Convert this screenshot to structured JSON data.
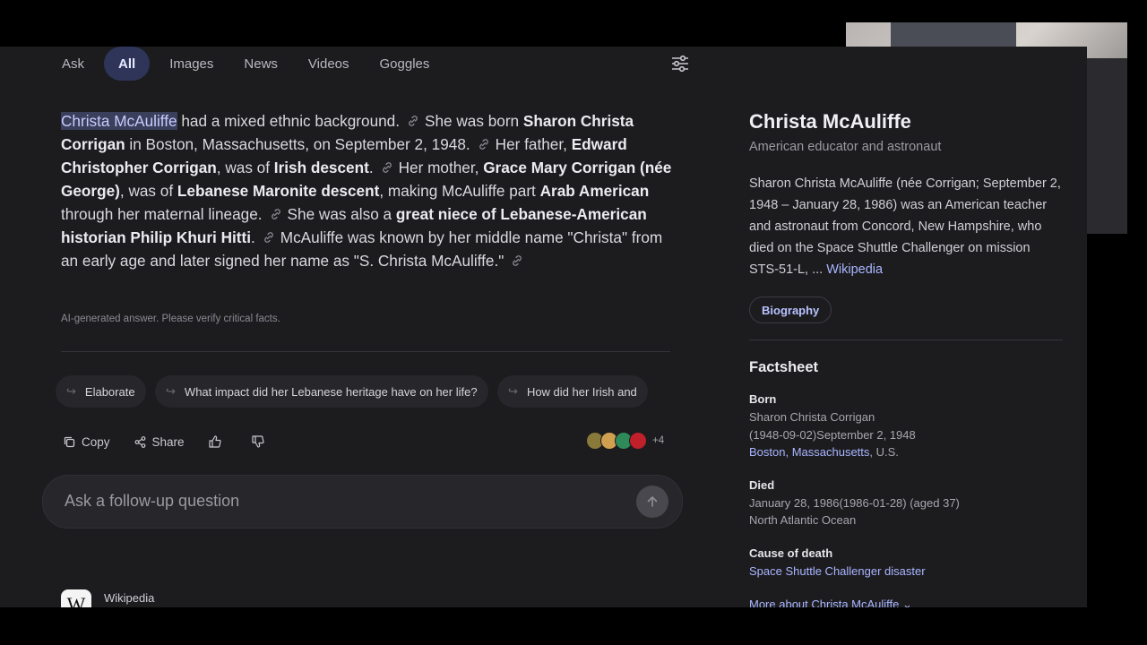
{
  "tabs": [
    {
      "label": "Ask",
      "active": false
    },
    {
      "label": "All",
      "active": true
    },
    {
      "label": "Images",
      "active": false
    },
    {
      "label": "News",
      "active": false
    },
    {
      "label": "Videos",
      "active": false
    },
    {
      "label": "Goggles",
      "active": false
    }
  ],
  "answer": {
    "s1_subject": "Christa McAuliffe",
    "s1_rest": " had a mixed ethnic background.",
    "s2_a": "She was born ",
    "s2_b": "Sharon Christa Corrigan",
    "s2_c": " in Boston, Massachusetts, on September 2, 1948.",
    "s3_a": "Her father, ",
    "s3_b": "Edward Christopher Corrigan",
    "s3_c": ", was of ",
    "s3_d": "Irish descent",
    "s3_e": ".",
    "s4_a": "Her mother, ",
    "s4_b": "Grace Mary Corrigan (née George)",
    "s4_c": ", was of ",
    "s4_d": "Lebanese Maronite descent",
    "s4_e": ", making McAuliffe part ",
    "s4_f": "Arab American",
    "s4_g": " through her maternal lineage.",
    "s5_a": "She was also a ",
    "s5_b": "great niece of Lebanese-American historian Philip Khuri Hitti",
    "s5_c": ".",
    "s6_a": "McAuliffe was known by her middle name \"Christa\" from an early age and later signed her name as \"S. Christa McAuliffe.\""
  },
  "disclaimer": "AI-generated answer. Please verify critical facts.",
  "chips": [
    "Elaborate",
    "What impact did her Lebanese heritage have on her life?",
    "How did her Irish and"
  ],
  "actions": {
    "copy": "Copy",
    "share": "Share"
  },
  "sources_more": "+4",
  "source_colors": [
    "#8a7a3a",
    "#d0a050",
    "#2f8a5a",
    "#c0202a"
  ],
  "followup": {
    "placeholder": "Ask a follow-up question"
  },
  "source_card": {
    "name": "Wikipedia",
    "logo": "W"
  },
  "panel": {
    "title": "Christa McAuliffe",
    "subtitle": "American educator and astronaut",
    "description": "Sharon Christa McAuliffe (née Corrigan; September 2, 1948 – January 28, 1986) was an American teacher and astronaut from Concord, New Hampshire, who died on the Space Shuttle Challenger on mission STS-51-L, ...",
    "desc_link": "Wikipedia",
    "bio_button": "Biography",
    "factsheet_title": "Factsheet",
    "born_label": "Born",
    "born_name": "Sharon Christa Corrigan",
    "born_date": "(1948-09-02)September 2, 1948",
    "born_place_link": "Boston, Massachusetts",
    "born_place_rest": ", U.S.",
    "died_label": "Died",
    "died_date": "January 28, 1986(1986-01-28) (aged 37)",
    "died_place": "North Atlantic Ocean",
    "cause_label": "Cause of death",
    "cause_link": "Space Shuttle Challenger disaster",
    "more_link": "More about Christa McAuliffe"
  },
  "colors": {
    "background": "#1c1c1f",
    "accent": "#a9b6ff",
    "active_tab": "#2e3558"
  }
}
